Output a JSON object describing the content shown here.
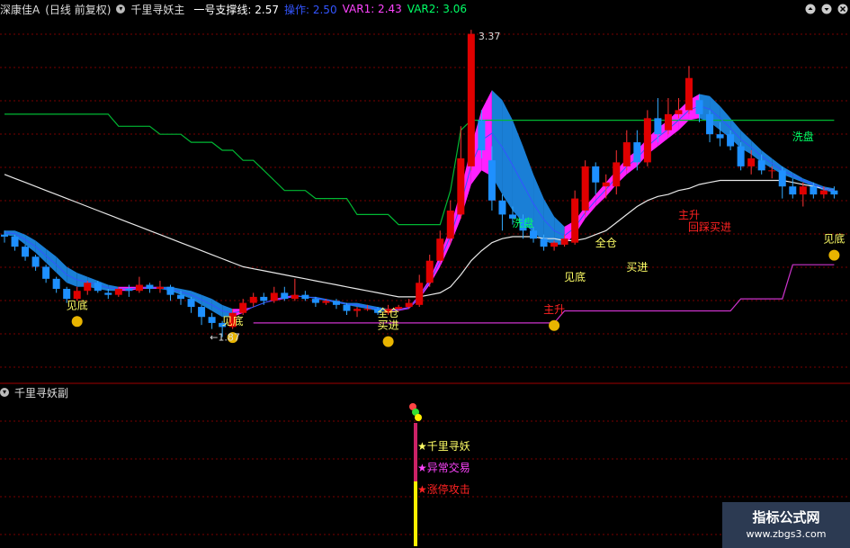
{
  "header": {
    "stock": "深康佳A",
    "period": "(日线 前复权)",
    "indicator": "千里寻妖主",
    "support_label": "一号支撑线: 2.57",
    "op_label": "操作: 2.50",
    "var1_label": "VAR1: 2.43",
    "var2_label": "VAR2: 3.06",
    "colors": {
      "stock": "#dddddd",
      "support": "#ffffff",
      "op": "#3355ff",
      "var1": "#ff44ff",
      "var2": "#00ff66"
    }
  },
  "sub_header": {
    "title": "千里寻妖副"
  },
  "watermark": {
    "line1": "指标公式网",
    "line2": "www.zbgs3.com"
  },
  "chart_data": {
    "type": "candlestick",
    "ylim": [
      1.72,
      3.45
    ],
    "x_count": 81,
    "candles": [
      [
        2.38,
        2.37,
        2.4,
        2.34
      ],
      [
        2.37,
        2.32,
        2.38,
        2.3
      ],
      [
        2.32,
        2.27,
        2.33,
        2.25
      ],
      [
        2.27,
        2.22,
        2.28,
        2.2
      ],
      [
        2.22,
        2.16,
        2.23,
        2.14
      ],
      [
        2.16,
        2.11,
        2.17,
        2.09
      ],
      [
        2.11,
        2.06,
        2.12,
        2.04
      ],
      [
        2.06,
        2.1,
        2.12,
        2.05
      ],
      [
        2.1,
        2.14,
        2.15,
        2.08
      ],
      [
        2.14,
        2.1,
        2.15,
        2.09
      ],
      [
        2.09,
        2.08,
        2.11,
        2.06
      ],
      [
        2.08,
        2.11,
        2.12,
        2.07
      ],
      [
        2.11,
        2.1,
        2.13,
        2.07
      ],
      [
        2.1,
        2.13,
        2.17,
        2.09
      ],
      [
        2.13,
        2.11,
        2.14,
        2.09
      ],
      [
        2.11,
        2.12,
        2.15,
        2.09
      ],
      [
        2.12,
        2.08,
        2.13,
        2.05
      ],
      [
        2.08,
        2.06,
        2.1,
        2.03
      ],
      [
        2.06,
        2.02,
        2.07,
        1.99
      ],
      [
        2.02,
        1.97,
        2.03,
        1.93
      ],
      [
        1.97,
        1.94,
        1.99,
        1.91
      ],
      [
        1.94,
        1.92,
        1.95,
        1.87
      ],
      [
        1.92,
        1.99,
        2.01,
        1.91
      ],
      [
        1.99,
        2.04,
        2.06,
        1.98
      ],
      [
        2.04,
        2.07,
        2.09,
        2.02
      ],
      [
        2.07,
        2.05,
        2.09,
        2.03
      ],
      [
        2.05,
        2.09,
        2.12,
        2.04
      ],
      [
        2.09,
        2.06,
        2.12,
        2.05
      ],
      [
        2.06,
        2.08,
        2.16,
        2.05
      ],
      [
        2.08,
        2.06,
        2.1,
        2.05
      ],
      [
        2.06,
        2.04,
        2.07,
        2.02
      ],
      [
        2.04,
        2.05,
        2.06,
        2.03
      ],
      [
        2.05,
        2.03,
        2.06,
        2.01
      ],
      [
        2.03,
        2.0,
        2.04,
        1.98
      ],
      [
        2.0,
        2.01,
        2.02,
        1.97
      ],
      [
        2.01,
        2.01,
        2.03,
        2.0
      ],
      [
        2.01,
        1.99,
        2.02,
        1.98
      ],
      [
        1.99,
        2.01,
        2.03,
        1.98
      ],
      [
        2.01,
        2.02,
        2.03,
        2.0
      ],
      [
        2.02,
        2.04,
        2.06,
        2.01
      ],
      [
        2.03,
        2.14,
        2.18,
        2.02
      ],
      [
        2.14,
        2.25,
        2.28,
        2.12
      ],
      [
        2.25,
        2.36,
        2.4,
        2.24
      ],
      [
        2.36,
        2.5,
        2.55,
        2.34
      ],
      [
        2.48,
        2.76,
        2.92,
        2.46
      ],
      [
        2.72,
        3.38,
        3.4,
        2.7
      ],
      [
        2.95,
        2.8,
        3.0,
        2.76
      ],
      [
        2.75,
        2.55,
        2.82,
        2.5
      ],
      [
        2.55,
        2.48,
        2.58,
        2.4
      ],
      [
        2.48,
        2.46,
        2.52,
        2.43
      ],
      [
        2.46,
        2.4,
        2.48,
        2.36
      ],
      [
        2.4,
        2.36,
        2.42,
        2.34
      ],
      [
        2.36,
        2.32,
        2.38,
        2.3
      ],
      [
        2.32,
        2.34,
        2.35,
        2.3
      ],
      [
        2.33,
        2.36,
        2.38,
        2.32
      ],
      [
        2.34,
        2.56,
        2.6,
        2.33
      ],
      [
        2.5,
        2.72,
        2.75,
        2.48
      ],
      [
        2.72,
        2.64,
        2.74,
        2.58
      ],
      [
        2.62,
        2.64,
        2.68,
        2.56
      ],
      [
        2.62,
        2.74,
        2.8,
        2.58
      ],
      [
        2.72,
        2.84,
        2.9,
        2.7
      ],
      [
        2.84,
        2.74,
        2.9,
        2.7
      ],
      [
        2.74,
        2.96,
        3.0,
        2.72
      ],
      [
        2.96,
        2.88,
        3.06,
        2.84
      ],
      [
        2.9,
        2.98,
        3.06,
        2.88
      ],
      [
        2.98,
        3.0,
        3.06,
        2.96
      ],
      [
        3.0,
        3.16,
        3.22,
        2.98
      ],
      [
        3.05,
        2.98,
        3.08,
        2.94
      ],
      [
        2.98,
        2.88,
        3.0,
        2.84
      ],
      [
        2.88,
        2.86,
        2.94,
        2.82
      ],
      [
        2.88,
        2.82,
        2.9,
        2.8
      ],
      [
        2.82,
        2.72,
        2.84,
        2.7
      ],
      [
        2.72,
        2.76,
        2.8,
        2.68
      ],
      [
        2.75,
        2.7,
        2.78,
        2.68
      ],
      [
        2.7,
        2.7,
        2.72,
        2.66
      ],
      [
        2.7,
        2.62,
        2.72,
        2.56
      ],
      [
        2.62,
        2.58,
        2.66,
        2.56
      ],
      [
        2.58,
        2.62,
        2.64,
        2.52
      ],
      [
        2.62,
        2.58,
        2.64,
        2.56
      ],
      [
        2.58,
        2.6,
        2.62,
        2.56
      ],
      [
        2.6,
        2.58,
        2.62,
        2.56
      ]
    ],
    "green_line": [
      2.98,
      2.98,
      2.98,
      2.98,
      2.98,
      2.98,
      2.98,
      2.98,
      2.98,
      2.98,
      2.98,
      2.92,
      2.92,
      2.92,
      2.92,
      2.88,
      2.88,
      2.88,
      2.84,
      2.84,
      2.84,
      2.8,
      2.8,
      2.75,
      2.75,
      2.7,
      2.65,
      2.6,
      2.6,
      2.6,
      2.56,
      2.56,
      2.56,
      2.56,
      2.48,
      2.48,
      2.48,
      2.48,
      2.43,
      2.43,
      2.43,
      2.43,
      2.43,
      2.6,
      2.9,
      2.95,
      2.95,
      2.95,
      2.95,
      2.95,
      2.95,
      2.95,
      2.95,
      2.95,
      2.95,
      2.95,
      2.95,
      2.95,
      2.95,
      2.95,
      2.95,
      2.95,
      2.95,
      2.95,
      2.95,
      2.95,
      2.95,
      2.95,
      2.95,
      2.95,
      2.95,
      2.95,
      2.95,
      2.95,
      2.95,
      2.95,
      2.95,
      2.95,
      2.95,
      2.95,
      2.95
    ],
    "white_line": [
      2.68,
      2.66,
      2.64,
      2.62,
      2.6,
      2.58,
      2.56,
      2.54,
      2.52,
      2.5,
      2.48,
      2.46,
      2.44,
      2.42,
      2.4,
      2.38,
      2.36,
      2.34,
      2.32,
      2.3,
      2.28,
      2.26,
      2.24,
      2.22,
      2.21,
      2.2,
      2.19,
      2.18,
      2.17,
      2.16,
      2.15,
      2.14,
      2.13,
      2.12,
      2.11,
      2.1,
      2.09,
      2.08,
      2.07,
      2.07,
      2.07,
      2.08,
      2.09,
      2.12,
      2.18,
      2.25,
      2.3,
      2.34,
      2.36,
      2.37,
      2.37,
      2.37,
      2.36,
      2.36,
      2.35,
      2.35,
      2.36,
      2.38,
      2.4,
      2.44,
      2.48,
      2.52,
      2.55,
      2.57,
      2.58,
      2.6,
      2.61,
      2.63,
      2.64,
      2.65,
      2.65,
      2.65,
      2.65,
      2.65,
      2.65,
      2.65,
      2.64,
      2.63,
      2.62,
      2.61,
      2.6
    ],
    "purple_line": [
      null,
      null,
      null,
      null,
      null,
      null,
      null,
      null,
      null,
      null,
      null,
      null,
      null,
      null,
      null,
      null,
      null,
      null,
      null,
      null,
      null,
      null,
      null,
      null,
      1.94,
      1.94,
      1.94,
      1.94,
      1.94,
      1.94,
      1.94,
      1.94,
      1.94,
      1.94,
      1.94,
      1.94,
      1.94,
      1.94,
      1.94,
      1.94,
      1.94,
      1.94,
      1.94,
      1.94,
      1.94,
      1.94,
      1.94,
      1.94,
      1.94,
      1.94,
      1.94,
      1.94,
      1.94,
      1.94,
      2.0,
      2.0,
      2.0,
      2.0,
      2.0,
      2.0,
      2.0,
      2.0,
      2.0,
      2.0,
      2.0,
      2.0,
      2.0,
      2.0,
      2.0,
      2.0,
      2.0,
      2.06,
      2.06,
      2.06,
      2.06,
      2.06,
      2.23,
      2.23,
      2.23,
      2.23,
      2.23
    ],
    "ribbon_low": [
      2.38,
      2.37,
      2.33,
      2.29,
      2.24,
      2.19,
      2.14,
      2.12,
      2.12,
      2.11,
      2.1,
      2.1,
      2.1,
      2.11,
      2.11,
      2.11,
      2.1,
      2.08,
      2.06,
      2.03,
      2.0,
      1.97,
      1.97,
      1.99,
      2.02,
      2.04,
      2.06,
      2.07,
      2.08,
      2.07,
      2.06,
      2.05,
      2.04,
      2.03,
      2.02,
      2.01,
      2.0,
      2.0,
      2.0,
      2.01,
      2.06,
      2.13,
      2.22,
      2.33,
      2.46,
      2.63,
      2.7,
      2.67,
      2.58,
      2.5,
      2.44,
      2.39,
      2.35,
      2.33,
      2.33,
      2.38,
      2.46,
      2.52,
      2.57,
      2.63,
      2.68,
      2.72,
      2.78,
      2.82,
      2.86,
      2.9,
      2.95,
      2.96,
      2.94,
      2.9,
      2.86,
      2.81,
      2.78,
      2.74,
      2.71,
      2.68,
      2.66,
      2.64,
      2.62,
      2.6,
      2.59
    ],
    "ribbon_high": [
      2.4,
      2.4,
      2.38,
      2.35,
      2.31,
      2.27,
      2.22,
      2.19,
      2.17,
      2.15,
      2.13,
      2.12,
      2.12,
      2.12,
      2.12,
      2.12,
      2.12,
      2.11,
      2.1,
      2.08,
      2.06,
      2.03,
      2.01,
      2.01,
      2.02,
      2.04,
      2.05,
      2.06,
      2.07,
      2.07,
      2.07,
      2.06,
      2.05,
      2.04,
      2.04,
      2.03,
      2.02,
      2.01,
      2.01,
      2.02,
      2.08,
      2.16,
      2.28,
      2.42,
      2.6,
      2.82,
      3.0,
      3.1,
      3.05,
      2.95,
      2.82,
      2.68,
      2.56,
      2.47,
      2.42,
      2.45,
      2.52,
      2.58,
      2.64,
      2.7,
      2.76,
      2.8,
      2.86,
      2.91,
      2.95,
      3.0,
      3.05,
      3.08,
      3.07,
      3.02,
      2.96,
      2.9,
      2.85,
      2.8,
      2.76,
      2.72,
      2.69,
      2.66,
      2.64,
      2.62,
      2.61
    ],
    "markers": [
      {
        "x": 7,
        "y": 2.01,
        "text": "见底",
        "color": "#ffff66",
        "bag": true
      },
      {
        "x": 22,
        "y": 1.93,
        "text": "见底",
        "color": "#ffff66",
        "bag": true
      },
      {
        "x": 37,
        "y": 1.97,
        "text": "全仓",
        "color": "#ffff66"
      },
      {
        "x": 37,
        "y": 1.91,
        "text": "买进",
        "color": "#ffff66",
        "bag": true
      },
      {
        "x": 55,
        "y": 2.15,
        "text": "见底",
        "color": "#ffff66"
      },
      {
        "x": 50,
        "y": 2.42,
        "text": "洗盘",
        "color": "#00ff66"
      },
      {
        "x": 53,
        "y": 1.99,
        "text": "主升",
        "color": "#ff2222",
        "bag": true
      },
      {
        "x": 58,
        "y": 2.32,
        "text": "全仓",
        "color": "#ffff66"
      },
      {
        "x": 61,
        "y": 2.2,
        "text": "买进",
        "color": "#ffff66"
      },
      {
        "x": 66,
        "y": 2.46,
        "text": "主升",
        "color": "#ff2222"
      },
      {
        "x": 68,
        "y": 2.4,
        "text": "回踩买进",
        "color": "#ff2222"
      },
      {
        "x": 77,
        "y": 2.85,
        "text": "洗盘",
        "color": "#00ff66"
      },
      {
        "x": 80,
        "y": 2.34,
        "text": "见底",
        "color": "#ffff66",
        "bag": true
      }
    ],
    "price_labels": [
      {
        "x": 45,
        "y": 3.37,
        "text": "3.37",
        "dir": "right"
      },
      {
        "x": 21,
        "y": 1.87,
        "text": "1.87",
        "dir": "left"
      }
    ],
    "sub_items": [
      {
        "text": "千里寻妖",
        "color": "#ffff66"
      },
      {
        "text": "异常交易",
        "color": "#ff44ff"
      },
      {
        "text": "涨停攻击",
        "color": "#ff2222"
      }
    ]
  }
}
